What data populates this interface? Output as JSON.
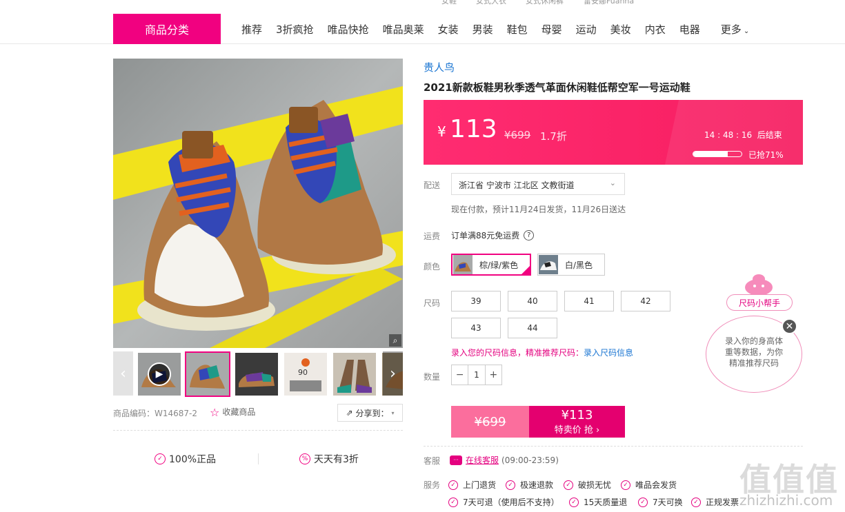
{
  "top_strip": {
    "links": [
      "女鞋",
      "女式大衣",
      "女式休闲裤",
      "雷安娜Fuanna"
    ]
  },
  "header": {
    "category_button": "商品分类",
    "nav": [
      "推荐",
      "3折疯抢",
      "唯品快抢",
      "唯品奥莱",
      "女装",
      "男装",
      "鞋包",
      "母婴",
      "运动",
      "美妆",
      "内衣",
      "电器"
    ],
    "more": "更多"
  },
  "gallery": {
    "sku_label": "商品编码：W14687-2",
    "favorite_label": "收藏商品",
    "share_label": "分享到："
  },
  "guarantees": [
    "100%正品",
    "天天有3折"
  ],
  "product": {
    "brand": "贵人鸟",
    "title": "2021新款板鞋男秋季透气革面休闲鞋低帮空军一号运动鞋"
  },
  "price": {
    "currency": "¥",
    "value": "113",
    "original": "¥699",
    "discount": "1.7折",
    "countdown": "14 : 48 : 16",
    "countdown_suffix": "后结束",
    "sold_percent": 0.71,
    "sold_text": "已抢71%",
    "accent_color": "#f61d60"
  },
  "delivery": {
    "label": "配送",
    "address": "浙江省 宁波市 江北区 文教街道",
    "info": "现在付款，预计11月24日发货，11月26日送达"
  },
  "freight": {
    "label": "运费",
    "text": "订单满88元免运费"
  },
  "colors": {
    "label": "颜色",
    "options": [
      "棕/绿/紫色",
      "白/黑色"
    ],
    "selected": "棕/绿/紫色"
  },
  "sizes": {
    "label": "尺码",
    "options": [
      "39",
      "40",
      "41",
      "42",
      "43",
      "44"
    ],
    "tip": "录入您的尺码信息，精准推荐尺码：",
    "tip_link": "录入尺码信息"
  },
  "quantity": {
    "label": "数量",
    "minus": "−",
    "value": "1",
    "plus": "+"
  },
  "buy": {
    "original": "¥699",
    "price": "¥113",
    "action": "特卖价 抢 ›"
  },
  "service_center": {
    "label": "客服",
    "link": "在线客服",
    "hours": "(09:00-23:59)"
  },
  "services": {
    "label": "服务",
    "items": [
      "上门退货",
      "极速退款",
      "破损无忧",
      "唯品会发货",
      "7天可退（使用后不支持）",
      "15天质量退",
      "7天可换",
      "正规发票"
    ]
  },
  "size_helper": {
    "tag": "尺码小帮手",
    "message": [
      "录入你的身高体",
      "重等数据，为你",
      "精准推荐尺码"
    ]
  },
  "watermark": {
    "big": "值值值",
    "small": "zhizhizhi.com"
  }
}
